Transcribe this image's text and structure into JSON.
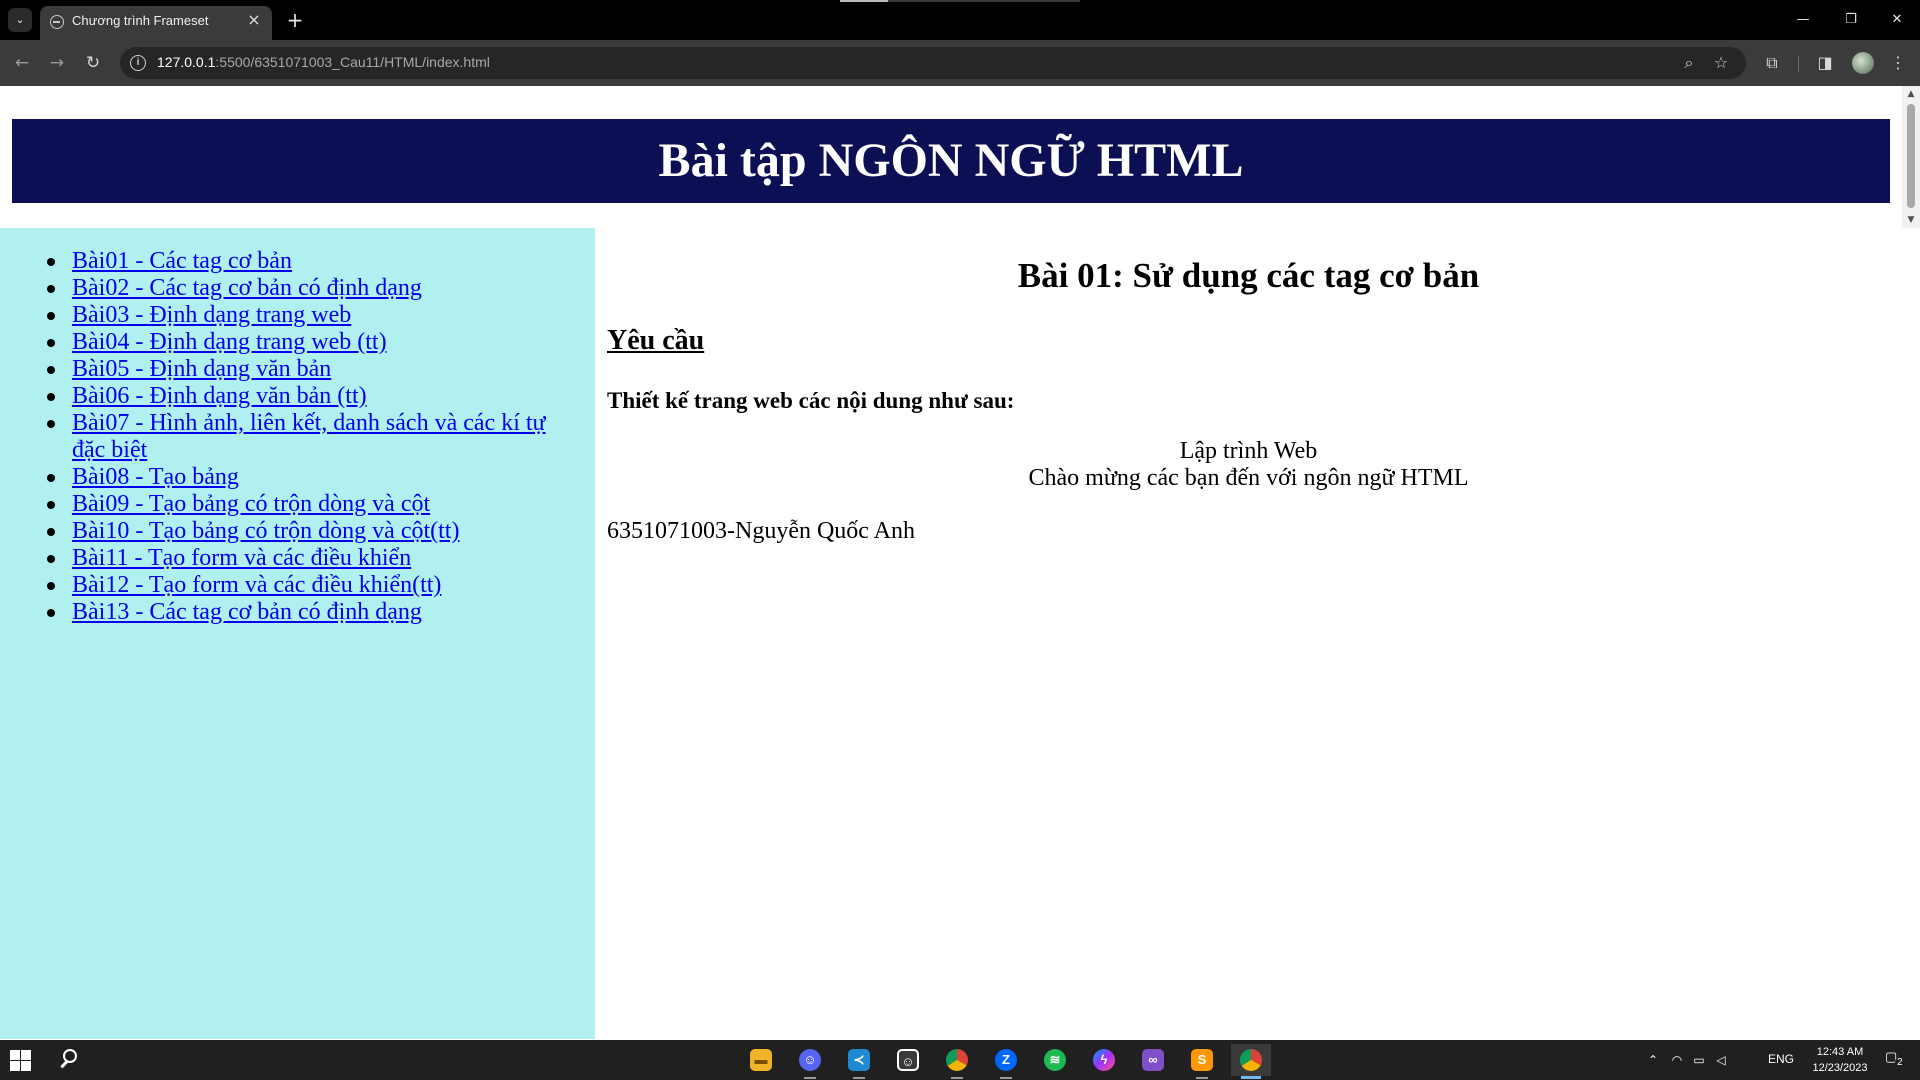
{
  "browser": {
    "tab_title": "Chương trình Frameset",
    "url_host": "127.0.0.1",
    "url_path": ":5500/6351071003_Cau11/HTML/index.html"
  },
  "header": {
    "banner_title": "Bài tập NGÔN NGỮ HTML",
    "banner_color": "#0d0f55"
  },
  "menu": {
    "background": "#b0f0f0",
    "items": [
      "Bài01 - Các tag cơ bản",
      "Bài02 - Các tag cơ bản có định dạng",
      "Bài03 - Định dạng trang web",
      "Bài04 - Định dạng trang web (tt)",
      "Bài05 - Định dạng văn bản",
      "Bài06 - Định dạng văn bản (tt)",
      "Bài07 - Hình ảnh, liên kết, danh sách và các kí tự đặc biệt",
      "Bài08 - Tạo bảng",
      "Bài09 - Tạo bảng có trộn dòng và cột",
      "Bài10 - Tạo bảng có trộn dòng và cột(tt)",
      "Bài11 - Tạo form và các điều khiển",
      "Bài12 - Tạo form và các điều khiển(tt)",
      "Bài13 - Các tag cơ bản có định dạng"
    ]
  },
  "content": {
    "title": "Bài 01: Sử dụng các tag cơ bản",
    "requirement_heading": "Yêu cầu",
    "requirement_text": "Thiết kế trang web các nội dung như sau:",
    "center_line1": "Lập trình Web",
    "center_line2": "Chào mừng các bạn đến với ngôn ngữ HTML",
    "student": "6351071003-Nguyễn Quốc Anh"
  },
  "taskbar": {
    "language": "ENG",
    "time": "12:43 AM",
    "date": "12/23/2023",
    "notification_count": "2",
    "pinned_apps": [
      "file-explorer",
      "discord",
      "vs-code",
      "messenger-app",
      "chrome",
      "zalo",
      "spotify",
      "messenger",
      "visual-studio",
      "sublime-text",
      "chrome-active"
    ]
  }
}
